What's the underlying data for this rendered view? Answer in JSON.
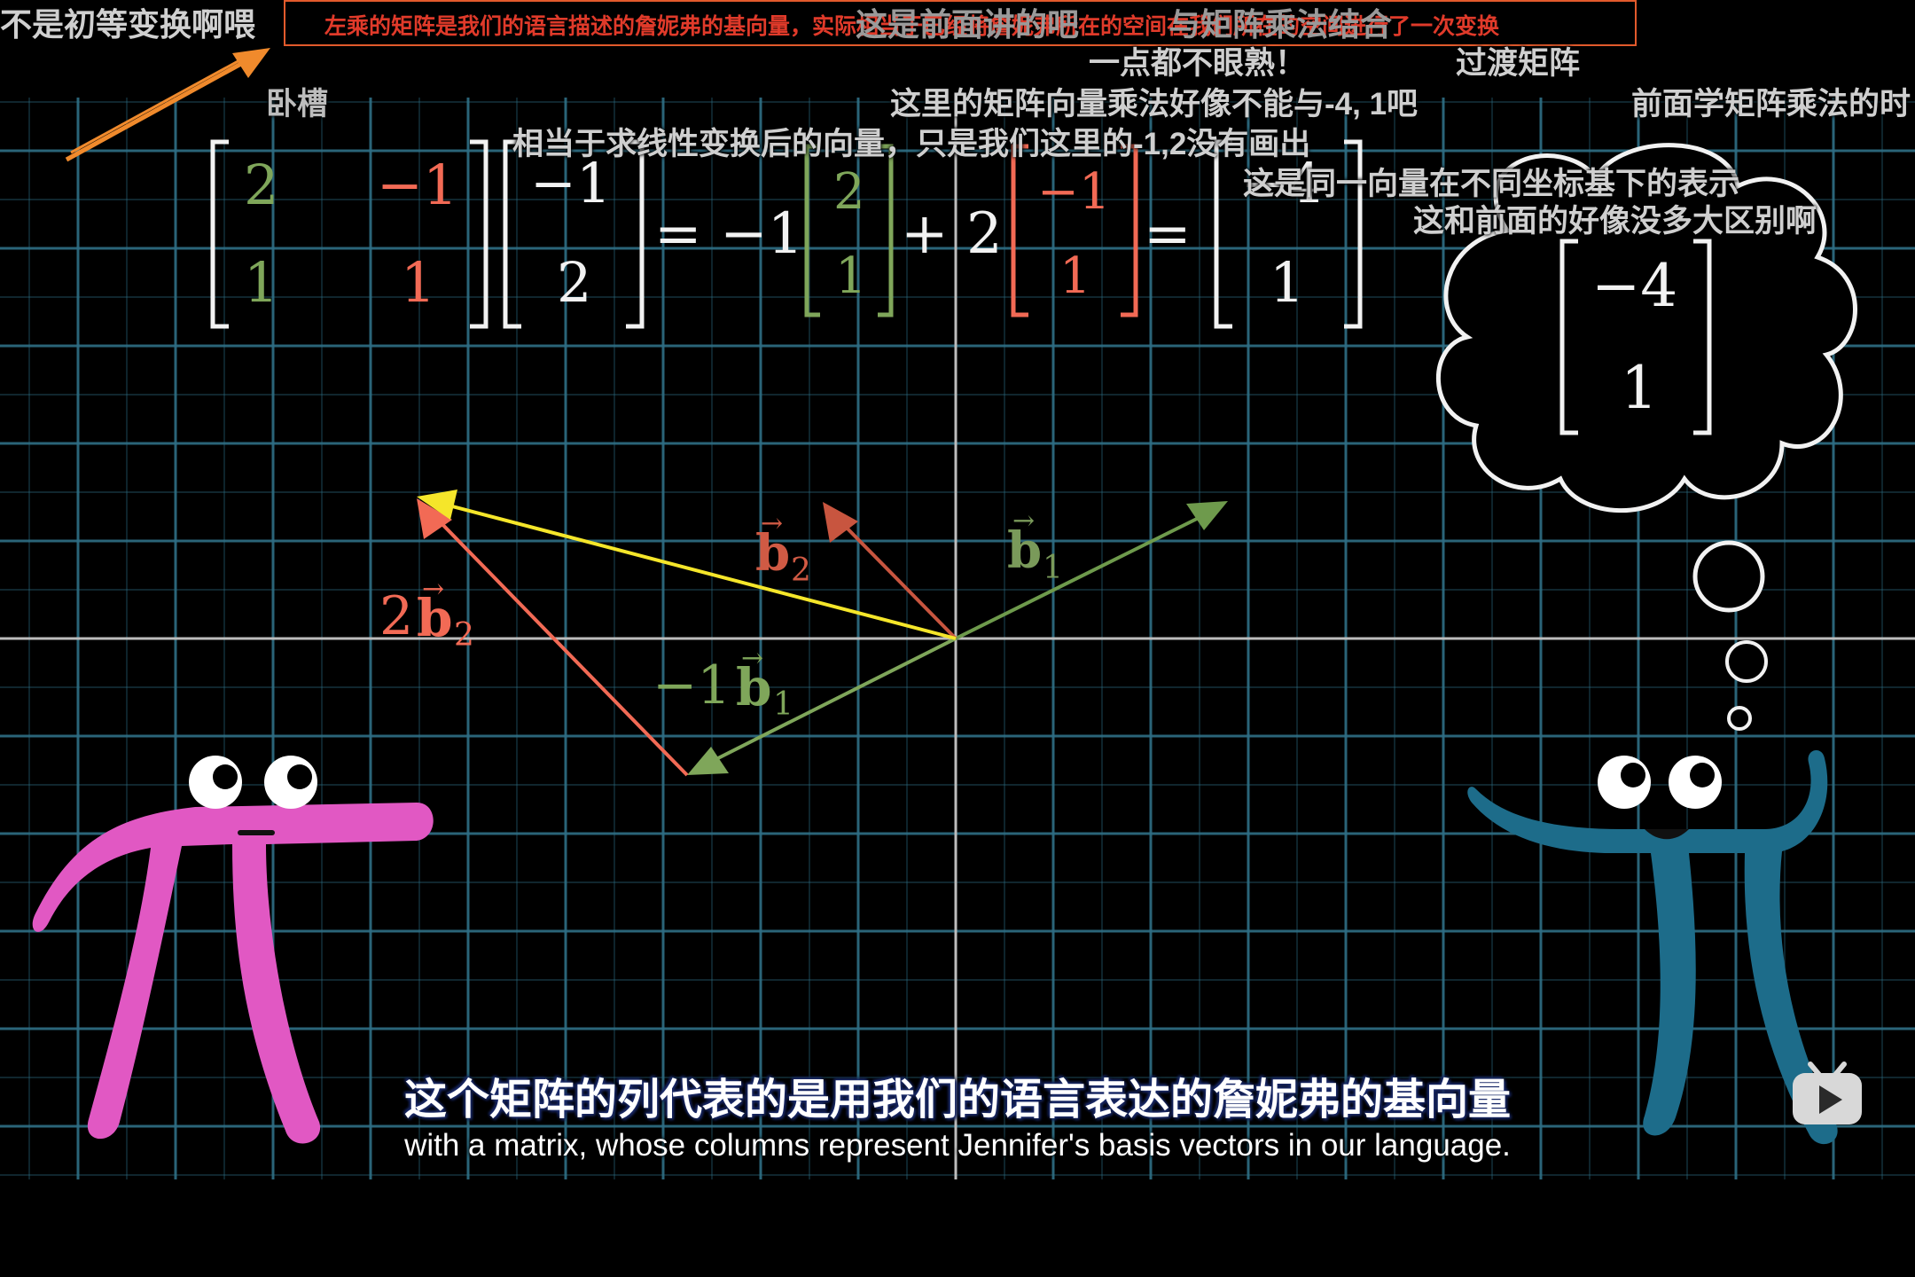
{
  "colors": {
    "grid": "#2f6f86",
    "axis": "#bdbdbd",
    "green": "#7fa65a",
    "red": "#f26a55",
    "yellow": "#f5e62a",
    "pink": "#e158c3",
    "blue": "#1d6c8a",
    "orange": "#f08a2c"
  },
  "overlay_note": "左乘的矩阵是我们的语言描述的詹妮弗的基向量，实际相当于已经将詹妮弗所在的空间在我们所在的空间进行了一次变换",
  "bullet_comments": [
    "不是初等变换啊喂",
    "这是前面讲的吧",
    "与矩阵乘法结合",
    "一点都不眼熟！",
    "过渡矩阵",
    "卧槽",
    "这里的矩阵向量乘法好像不能与-4, 1吧",
    "前面学矩阵乘法的时",
    "相当于求线性变换后的向量，只是我们这里的-1,2没有画出",
    "这是同一向量在不同坐标基下的表示",
    "这和前面的好像没多大区别啊"
  ],
  "equation": {
    "matrix": [
      [
        "2",
        "−1"
      ],
      [
        "1",
        "1"
      ]
    ],
    "vector": [
      "−1",
      "2"
    ],
    "coef1": "= −1",
    "col1": [
      "2",
      "1"
    ],
    "plus_coef2": "+ 2",
    "col2": [
      "−1",
      "1"
    ],
    "equals": "=",
    "result": [
      "−4",
      "1"
    ]
  },
  "thought_bubble_vector": [
    "−4",
    "1"
  ],
  "vector_labels": {
    "b2": "b",
    "b2_sub": "2",
    "b1": "b",
    "b1_sub": "1",
    "two_b2_coef": "2",
    "neg_b1_coef": "−1"
  },
  "subtitle": {
    "zh": "这个矩阵的列代表的是用我们的语言表达的詹妮弗的基向量",
    "en": "with a matrix, whose columns represent Jennifer's basis vectors in our language."
  },
  "controls": {
    "play_icon": "play-icon"
  }
}
